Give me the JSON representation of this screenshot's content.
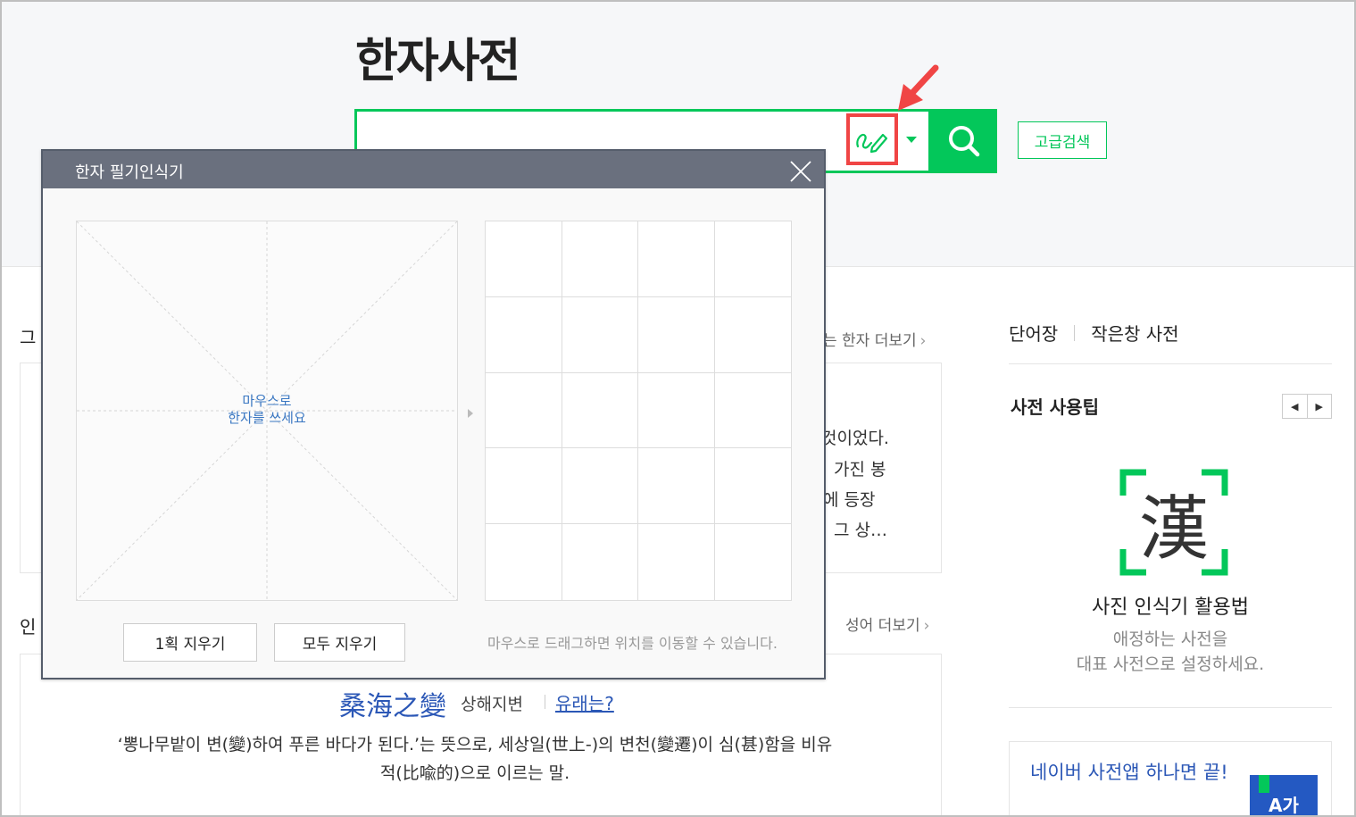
{
  "header": {
    "logo": "한자사전",
    "search_value": "",
    "advanced_search_label": "고급검색"
  },
  "main": {
    "section1_title_partial": "그",
    "section1_more": "는 한자 더보기",
    "section1_lines": [
      "것이었다.",
      "가진 봉",
      "에 등장",
      "그 상…"
    ],
    "section2_title_partial": "인",
    "section2_more": "성어 더보기",
    "idiom": {
      "hanja": "桑海之變",
      "reading": "상해지변",
      "origin_link": "유래는?",
      "description_line1": "‘뽕나무밭이 변(變)하여 푸른 바다가 된다.’는 뜻으로, 세상일(世上-)의 변천(變遷)이 심(甚)함을 비유",
      "description_line2": "적(比喩的)으로 이르는 말."
    }
  },
  "right": {
    "link_wordbook": "단어장",
    "link_mini_dict": "작은창 사전",
    "tip_title": "사전 사용팁",
    "tip_icon_char": "漢",
    "tip_subtitle": "사진 인식기 활용법",
    "tip_desc_line1": "애정하는 사전을",
    "tip_desc_line2": "대표 사전으로 설정하세요.",
    "app_text": "네이버 사전앱 하나면 끝!",
    "app_icon_text": "A가"
  },
  "popup": {
    "title": "한자 필기인식기",
    "canvas_hint_line1": "마우스로",
    "canvas_hint_line2": "한자를 쓰세요",
    "clear_one_label": "1획 지우기",
    "clear_all_label": "모두 지우기",
    "drag_hint": "마우스로 드래그하면 위치를 이동할 수 있습니다."
  },
  "colors": {
    "brand_green": "#03c75a",
    "highlight_red": "#f04545",
    "link_blue": "#2b57b6",
    "popup_header": "#6a707e"
  },
  "icons": [
    "pen-icon",
    "caret-down-icon",
    "search-icon",
    "arrow-annotation-icon",
    "close-icon",
    "hanja-scan-icon",
    "chevron-left-icon",
    "chevron-right-icon",
    "bookmark-icon"
  ]
}
